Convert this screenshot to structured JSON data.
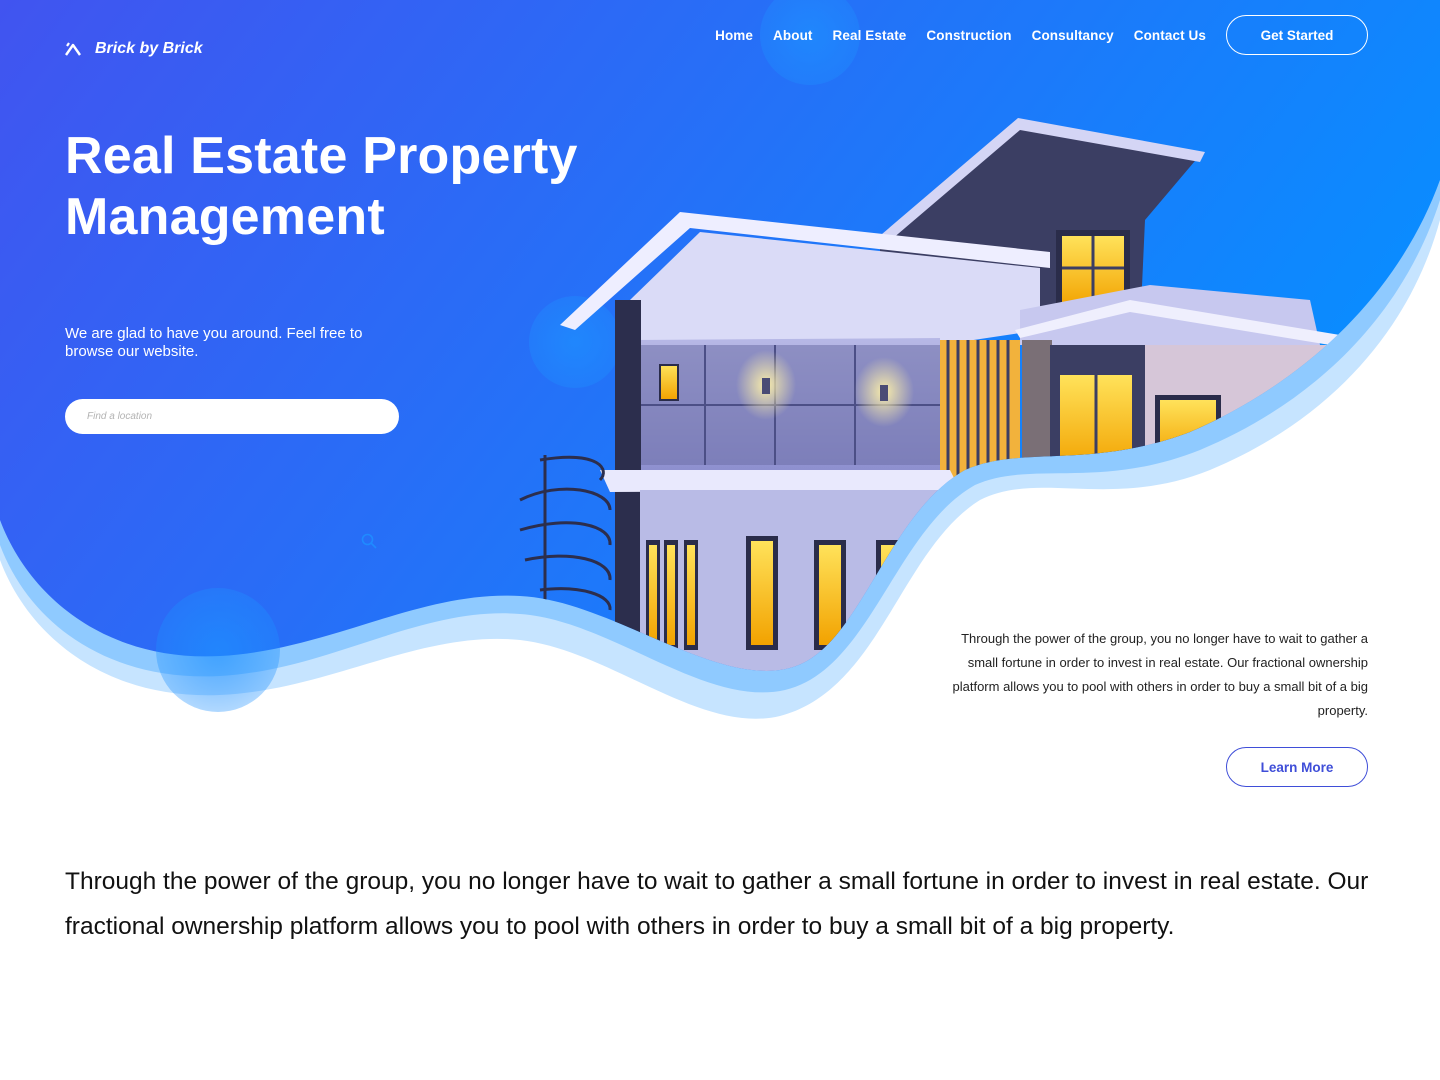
{
  "brand": {
    "name": "Brick by Brick",
    "logo_icon": "chevron-logo-icon"
  },
  "nav": {
    "links": [
      "Home",
      "About",
      "Real Estate",
      "Construction",
      "Consultancy",
      "Contact Us"
    ],
    "cta": "Get Started"
  },
  "hero": {
    "title": "Real Estate Property Management",
    "subtitle": "We are glad to have you around. Feel free to browse our website.",
    "search_placeholder": "Find a location",
    "search_icon": "search-icon"
  },
  "info": {
    "text": "Through the power of the group, you no longer have to wait to gather a small fortune in order to invest in real estate. Our fractional ownership platform allows you to pool with others in order to buy a small bit of a big property.",
    "button": "Learn More"
  },
  "body": {
    "text": "Through the power of the group, you no longer have to wait to gather a small fortune in order to invest in real estate. Our fractional ownership platform allows you to pool with others in order to buy a small bit of a big property."
  },
  "colors": {
    "gradient_start": "#4154f0",
    "gradient_end": "#0a8cff",
    "wave_light": "#c6e4ff",
    "wave_mid": "#8fcaff",
    "accent": "#3f4ed8"
  }
}
